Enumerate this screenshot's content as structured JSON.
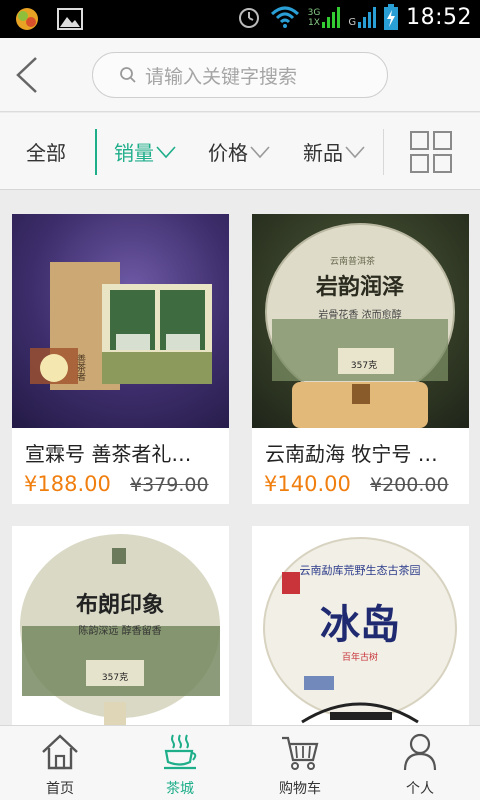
{
  "status_bar": {
    "time": "18:52",
    "network_label_top": "3G",
    "network_label_bottom": "1X",
    "network_label_g": "G"
  },
  "header": {
    "search_placeholder": "请输入关键字搜索"
  },
  "filters": [
    {
      "label": "全部",
      "active": false
    },
    {
      "label": "销量",
      "active": true
    },
    {
      "label": "价格",
      "active": false
    },
    {
      "label": "新品",
      "active": false
    }
  ],
  "products": [
    {
      "name": "宣霖号 善茶者礼…",
      "price": "¥188.00",
      "original_price": "¥379.00",
      "image_text": "善茶者"
    },
    {
      "name": "云南勐海 牧宁号 …",
      "price": "¥140.00",
      "original_price": "¥200.00",
      "image_text": "岩韵润泽",
      "image_subtext": "岩骨花香 浓而愈醇",
      "image_band": "云南普洱茶",
      "image_net": "357克"
    },
    {
      "name": "",
      "price": "",
      "original_price": "",
      "image_text": "布朗印象",
      "image_subtext": "陈韵深远 醇香留香",
      "image_net": "357克"
    },
    {
      "name": "",
      "price": "",
      "original_price": "",
      "image_text": "冰岛",
      "image_arc": "云南勐库荒野生态古茶园",
      "image_subtext": "百年古树"
    }
  ],
  "tabs": [
    {
      "label": "首页",
      "icon": "home-icon",
      "active": false
    },
    {
      "label": "茶城",
      "icon": "tea-cup-icon",
      "active": true
    },
    {
      "label": "购物车",
      "icon": "cart-icon",
      "active": false
    },
    {
      "label": "个人",
      "icon": "person-icon",
      "active": false
    }
  ],
  "colors": {
    "accent": "#1fae8a",
    "price": "#f07f10"
  }
}
